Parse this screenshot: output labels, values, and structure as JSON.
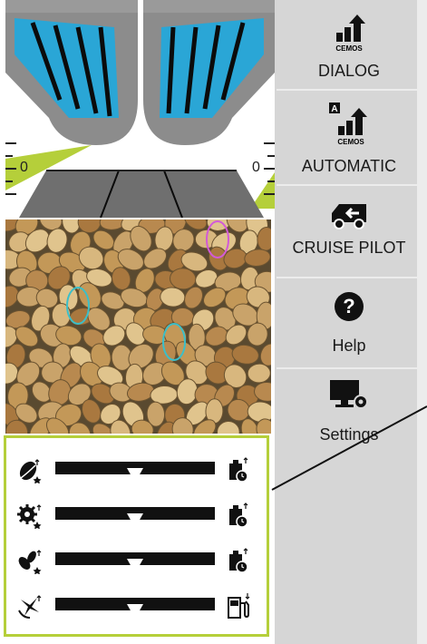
{
  "scene": {
    "left_indicator": "0",
    "right_indicator": "0"
  },
  "menu": [
    {
      "id": "dialog",
      "label": "DIALOG",
      "icon": "cemos-dialog-icon"
    },
    {
      "id": "automatic",
      "label": "AUTOMATIC",
      "icon": "cemos-automatic-icon"
    },
    {
      "id": "cruise-pilot",
      "label": "CRUISE PILOT",
      "icon": "cruise-pilot-icon"
    },
    {
      "id": "help",
      "label": "Help",
      "icon": "help-icon"
    },
    {
      "id": "settings",
      "label": "Settings",
      "icon": "settings-icon"
    }
  ],
  "icon_texts": {
    "cemos": "CEMOS",
    "automatic_badge": "A",
    "help_glyph": "?"
  },
  "sliders": [
    {
      "id": "grain-quality",
      "priority_icon": "grain-quality-priority-icon",
      "target_icon": "weight-time-icon",
      "value": 0.5
    },
    {
      "id": "threshing",
      "priority_icon": "threshing-priority-icon",
      "target_icon": "weight-time-icon",
      "value": 0.5
    },
    {
      "id": "straw-quality",
      "priority_icon": "straw-quality-priority-icon",
      "target_icon": "weight-time-icon",
      "value": 0.5
    },
    {
      "id": "cleaning-losses",
      "priority_icon": "cleaning-loss-priority-icon",
      "target_icon": "fuel-consumption-icon",
      "value": 0.5
    }
  ],
  "colors": {
    "accent_green": "#b5cf3a",
    "machine_blue": "#2aa6d6",
    "panel_grey": "#d6d6d6"
  }
}
